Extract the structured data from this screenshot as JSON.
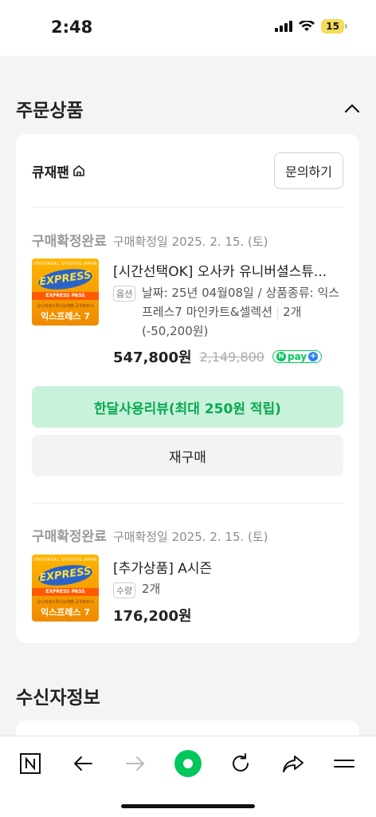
{
  "status_bar": {
    "time": "2:48",
    "battery": "15"
  },
  "sections": {
    "order_title": "주문상품",
    "receiver_title": "수신자정보"
  },
  "shop": {
    "name": "큐재팬",
    "inquiry_label": "문의하기"
  },
  "orders": [
    {
      "status": "구매확정완료",
      "date": "구매확정일 2025. 2. 15. (토)",
      "title": "[시간선택OK] 오사카 유니버셜스튜...",
      "option_badge": "옵션",
      "option_text_a": "날짜: 25년 04월08일 / 상품종류: 익스프레스7 마인카트&셀렉션",
      "option_text_b": "2개 (-50,200원)",
      "price": "547,800원",
      "original_price": "2,149,800",
      "npay_label": "pay",
      "review_label": "한달사용리뷰(최대 250원 적립)",
      "rebuy_label": "재구매"
    },
    {
      "status": "구매확정완료",
      "date": "구매확정일 2025. 2. 15. (토)",
      "title": "[추가상품] A시즌",
      "option_badge": "수량",
      "option_text": "2개",
      "price": "176,200원"
    }
  ],
  "thumbnail": {
    "brand": "UNIVERSAL STUDIOS JAPAN",
    "logo": "EXPRESS",
    "band": "EXPRESS PASS",
    "small": "유니버설스튜디오재팬 공식파트너",
    "name": "익스프레스 7"
  },
  "icons": [
    "signal-icon",
    "wifi-icon",
    "home-outline-icon",
    "chevron-up-icon",
    "naver-n-icon",
    "back-arrow-icon",
    "forward-arrow-icon",
    "naver-green-dot-icon",
    "refresh-icon",
    "share-icon",
    "menu-icon"
  ]
}
